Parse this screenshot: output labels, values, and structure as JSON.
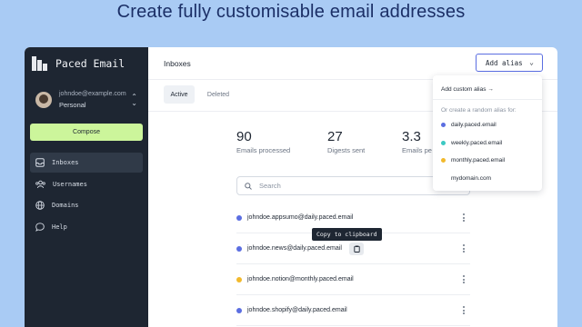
{
  "headline": "Create fully customisable email addresses",
  "app": {
    "brand": "Paced Email",
    "account": {
      "email": "johndoe@example.com",
      "plan": "Personal"
    },
    "compose_label": "Compose",
    "nav": [
      {
        "label": "Inboxes",
        "icon": "inbox-icon",
        "active": true
      },
      {
        "label": "Usernames",
        "icon": "users-icon",
        "active": false
      },
      {
        "label": "Domains",
        "icon": "globe-icon",
        "active": false
      },
      {
        "label": "Help",
        "icon": "chat-bubble-icon",
        "active": false
      }
    ]
  },
  "header": {
    "title": "Inboxes",
    "alias_button": "Add alias"
  },
  "tabs": [
    {
      "label": "Active",
      "active": true
    },
    {
      "label": "Deleted",
      "active": false
    }
  ],
  "stats": [
    {
      "value": "90",
      "label": "Emails processed"
    },
    {
      "value": "27",
      "label": "Digests sent"
    },
    {
      "value": "3.3",
      "label": "Emails pe"
    }
  ],
  "search": {
    "placeholder": "Search"
  },
  "tooltip": "Copy to clipboard",
  "inboxes": [
    {
      "address": "johndoe.appsumo@daily.paced.email",
      "color": "#5b6ee1"
    },
    {
      "address": "johndoe.news@daily.paced.email",
      "color": "#5b6ee1"
    },
    {
      "address": "johndoe.notion@monthly.paced.email",
      "color": "#f2b92c"
    },
    {
      "address": "johndoe.shopify@daily.paced.email",
      "color": "#5b6ee1"
    }
  ],
  "dropdown": {
    "custom": "Add custom alias →",
    "hint": "Or create a random alias for:",
    "items": [
      {
        "label": "daily.paced.email",
        "color": "#5b6ee1"
      },
      {
        "label": "weekly.paced.email",
        "color": "#3cc8c2"
      },
      {
        "label": "monthly.paced.email",
        "color": "#f2b92c"
      },
      {
        "label": "mydomain.com",
        "color": ""
      }
    ]
  },
  "colors": {
    "sidebar": "#1e2632",
    "compose": "#ccf59b",
    "accent": "#5b6ee1",
    "background": "#a9cbf4"
  }
}
